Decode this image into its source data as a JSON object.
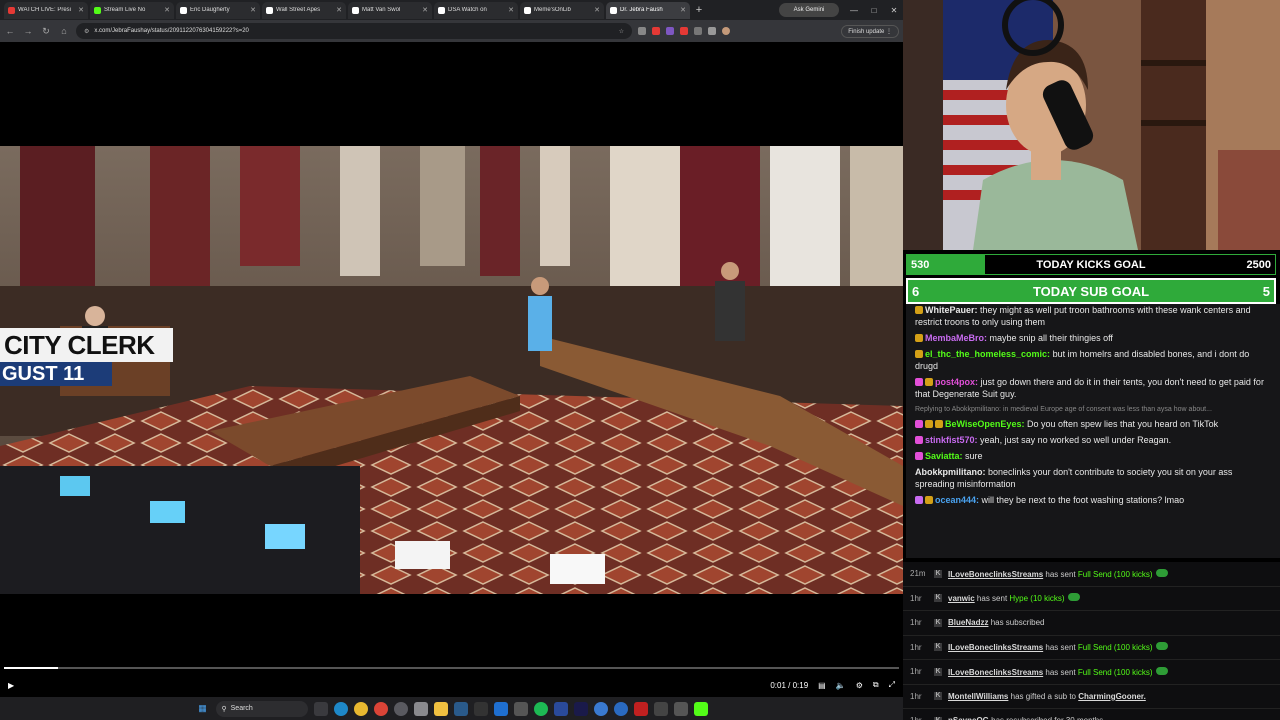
{
  "browser": {
    "tabs": [
      {
        "label": "WATCH LIVE: Presi",
        "color": "#e53935"
      },
      {
        "label": "Stream Live No",
        "color": "#53fc18"
      },
      {
        "label": "Eric Daugherty",
        "color": "#ffffff"
      },
      {
        "label": "Wall Street Apes",
        "color": "#ffffff"
      },
      {
        "label": "Matt Van Swol",
        "color": "#ffffff"
      },
      {
        "label": "DSA Watch on",
        "color": "#ffffff"
      },
      {
        "label": "Meme'sOnLib",
        "color": "#ffffff"
      },
      {
        "label": "Dr. Jebra Faush",
        "color": "#ffffff",
        "active": true
      }
    ],
    "new_tab": "+",
    "ask_gemini": "Ask Gemini",
    "url": "x.com/JebraFaushay/status/2091122076304159222?s=20",
    "finish_update": "Finish update"
  },
  "video": {
    "overlay_title": "CITY CLERK",
    "overlay_date": "GUST 11",
    "time_current": "0:01",
    "time_total": "0:19",
    "progress": 0.06
  },
  "taskbar": {
    "search_placeholder": "Search"
  },
  "goals": [
    {
      "current": "530",
      "title": "TODAY KICKS GOAL",
      "target": "2500",
      "progress": 0.212
    },
    {
      "current": "6",
      "title": "TODAY SUB GOAL",
      "target": "5",
      "progress": 1.0
    }
  ],
  "chat": [
    {
      "user": "WhitePauer:",
      "text": "they might as well put troon bathrooms with these wank centers and restrict troons to only using them",
      "color": "#e8e8e8",
      "badges": [
        "#d4a017"
      ]
    },
    {
      "user": "MembaMeBro:",
      "text": "maybe snip all their thingies off",
      "color": "#c86bf0",
      "badges": [
        "#d4a017"
      ]
    },
    {
      "user": "el_thc_the_homeless_comic:",
      "text": "but im homelrs and disabled bones, and i dont do drugd",
      "color": "#53fc18",
      "badges": [
        "#d4a017"
      ]
    },
    {
      "user": "post4pox:",
      "text": "just go down there and do it in their tents, you don't need to get paid for that Degenerate Suit guy.",
      "color": "#e24fd8",
      "badges": [
        "#e24fd8",
        "#d4a017"
      ]
    },
    {
      "reply": "Replying to Abokkpmilitano: in medieval Europe age of consent was less than aysa how about...",
      "user": "BeWiseOpenEyes:",
      "text": "Do you often spew lies that you heard on TikTok",
      "color": "#53fc18",
      "badges": [
        "#e24fd8",
        "#d4a017",
        "#d4a017"
      ]
    },
    {
      "user": "stinkfist570:",
      "text": "yeah, just say no worked so well under Reagan.",
      "color": "#c86bf0",
      "badges": [
        "#e24fd8"
      ]
    },
    {
      "user": "Saviatta:",
      "text": "sure",
      "color": "#53fc18",
      "badges": [
        "#e24fd8"
      ]
    },
    {
      "user": "Abokkpmilitano:",
      "text": "boneclinks your don't contribute to society you sit on your ass spreading misinformation",
      "color": "#e8e8e8",
      "badges": []
    },
    {
      "user": "ocean444:",
      "text": "will they be next to the foot washing stations? lmao",
      "color": "#4aa3f0",
      "badges": [
        "#c86bf0",
        "#d4a017"
      ]
    }
  ],
  "events": [
    {
      "time": "21m",
      "name": "ILoveBoneclinksStreams",
      "verb": "has sent",
      "amount": "Full Send (100 kicks)",
      "kick": true
    },
    {
      "time": "1hr",
      "name": "vanwic",
      "verb": "has sent",
      "amount": "Hype (10 kicks)",
      "kick": true
    },
    {
      "time": "1hr",
      "name": "BlueNadzz",
      "verb": "has subscribed",
      "amount": "",
      "kick": false
    },
    {
      "time": "1hr",
      "name": "ILoveBoneclinksStreams",
      "verb": "has sent",
      "amount": "Full Send (100 kicks)",
      "kick": true
    },
    {
      "time": "1hr",
      "name": "ILoveBoneclinksStreams",
      "verb": "has sent",
      "amount": "Full Send (100 kicks)",
      "kick": true
    },
    {
      "time": "1hr",
      "name": "MontellWilliams",
      "verb": "has gifted a sub to",
      "amount": "CharmingGooner.",
      "kick": false
    },
    {
      "time": "1hr",
      "name": "nSayneOG",
      "verb": "has resubscribed for 30 months",
      "amount": "",
      "kick": false
    }
  ]
}
